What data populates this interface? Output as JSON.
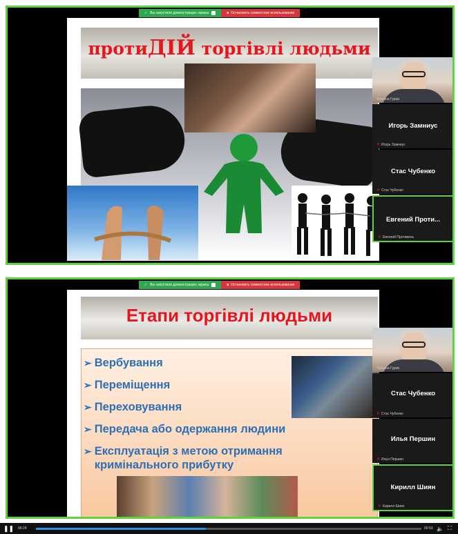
{
  "sharebar": {
    "info_text": "Вы запустили демонстрацию экрана",
    "stop_text": "Остановить совместное использование"
  },
  "slide1": {
    "title_prefix": "проти",
    "title_big": "ДІЙ",
    "title_suffix": " торгівлі людьми"
  },
  "slide2": {
    "title": "Етапи торгівлі людьми",
    "bullets": [
      {
        "text": "Вербування"
      },
      {
        "text": "Переміщення"
      },
      {
        "text": "Переховування"
      },
      {
        "text": "Передача або одержання людини"
      },
      {
        "text": "Експлуатація з метою отримання кримінального прибутку"
      }
    ]
  },
  "participants1": [
    {
      "small_label": "Татьяна Гуркіз",
      "name": ""
    },
    {
      "name": "Игорь Замниус",
      "small_label": "Игорь Замниус"
    },
    {
      "name": "Стас Чубенко",
      "small_label": "Стас Чубенко"
    },
    {
      "name": "Евгений Проти...",
      "small_label": "Евгений Противень"
    }
  ],
  "participants2": [
    {
      "small_label": "Татьяна Гуркіз",
      "name": ""
    },
    {
      "name": "Стас Чубенко",
      "small_label": "Стас Чубенко"
    },
    {
      "name": "Илья Першин",
      "small_label": "Илья Першин"
    },
    {
      "name": "Кирилл Шиян",
      "small_label": "Кирилл Шиян"
    }
  ],
  "player": {
    "current_time": "06:24",
    "total_time": "00:53",
    "progress": 0.44
  },
  "colors": {
    "title_red": "#e5161d",
    "bullet_blue": "#2d6fb5",
    "share_green": "#5fd33a",
    "stop_red": "#d8353c"
  }
}
